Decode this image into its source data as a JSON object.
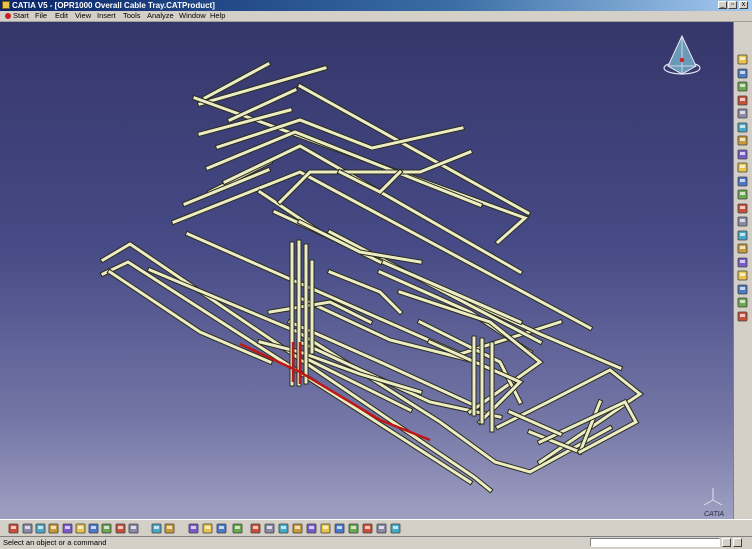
{
  "window": {
    "title": "CATIA V5 - [OPR1000 Overall Cable Tray.CATProduct]",
    "minimize_glyph": "_",
    "restore_glyph": "▫",
    "close_glyph": "x"
  },
  "menu": {
    "items": [
      "Start",
      "File",
      "Edit",
      "View",
      "Insert",
      "Tools",
      "Analyze",
      "Window",
      "Help"
    ]
  },
  "status": {
    "message": "Select an object or a command"
  },
  "compass": {
    "icon": "compass-icon"
  },
  "axis_label": {
    "icon": "xyz-axis-icon"
  },
  "catia_logo": "CATIA",
  "colors": {
    "tray": "#ecedc4",
    "tray_outline": "#2a2c1c",
    "highlight": "#c01818",
    "background_top": "#35366a",
    "background_bottom": "#9ea0c2"
  },
  "right_toolbar_icons": [
    "select-icon",
    "product-icon",
    "component-icon",
    "existing-component-icon",
    "replace-icon",
    "graph-tree-icon",
    "generate-numbering-icon",
    "selective-load-icon",
    "manage-representations-icon",
    "multi-instantiation-icon",
    "fast-multi-instantiation-icon",
    "reorder-icon",
    "constraint-icon",
    "fix-icon",
    "snap-icon",
    "explode-icon",
    "stop-manipulation-icon",
    "catalog-icon",
    "light-icon",
    "clash-icon"
  ],
  "bottom_toolbar_icons": [
    "new-icon",
    "open-icon",
    "save-icon",
    "print-icon",
    "cut-icon",
    "copy-icon",
    "paste-icon",
    "undo-icon",
    "redo-icon",
    "whats-this-icon",
    "formula-icon",
    "comment-icon",
    "catalog-browser-icon",
    "update-icon",
    "measure-icon",
    "fly-mode-icon",
    "fit-all-icon",
    "pan-icon",
    "rotate-icon",
    "zoom-in-icon",
    "zoom-out-icon",
    "normal-view-icon",
    "iso-view-icon",
    "shading-icon",
    "hide-show-icon",
    "swap-space-icon",
    "visible-space-icon"
  ]
}
